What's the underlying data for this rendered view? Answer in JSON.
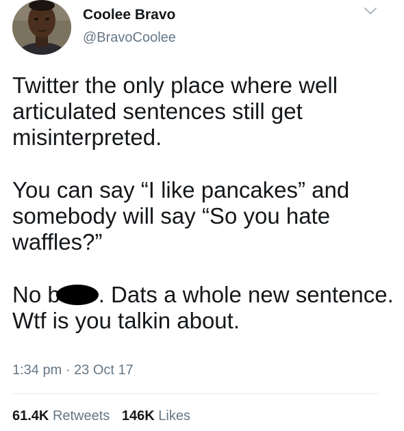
{
  "author": {
    "display_name": "Coolee Bravo",
    "handle": "@BravoCoolee",
    "avatar_icon": "profile-photo"
  },
  "tweet": {
    "paragraphs": [
      {
        "text": "Twitter the only place where well articulated sentences still get misinterpreted."
      },
      {
        "text": "You can say “I like pancakes” and somebody will say “So you hate waffles?”"
      },
      {
        "before_redaction": "No b",
        "after_redaction": ". Dats a whole new sentence. Wtf is you talkin about."
      }
    ],
    "timestamp": "1:34 pm · 23 Oct 17"
  },
  "stats": {
    "retweets_count": "61.4K",
    "retweets_label": "Retweets",
    "likes_count": "146K",
    "likes_label": "Likes"
  },
  "colors": {
    "text": "#14171a",
    "secondary": "#657786",
    "divider": "#e1e8ed"
  }
}
